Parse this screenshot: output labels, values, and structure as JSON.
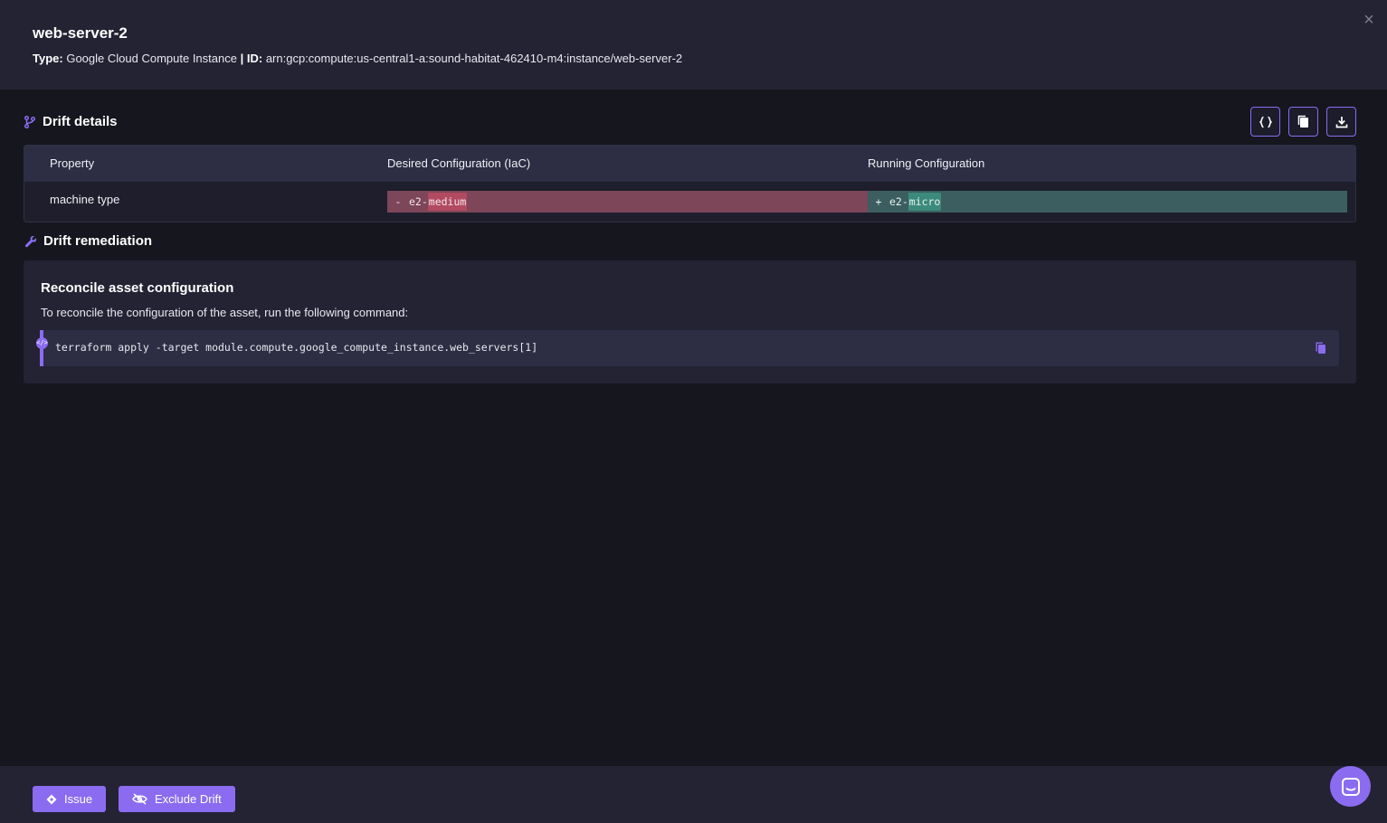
{
  "asset": {
    "name": "web-server-2",
    "type_label": "Type:",
    "type_value": "Google Cloud Compute Instance",
    "separator": "|",
    "id_label": "ID:",
    "id_value": "arn:gcp:compute:us-central1-a:sound-habitat-462410-m4:instance/web-server-2"
  },
  "close_icon": "×",
  "drift_details": {
    "title": "Drift details",
    "icon": "branch-icon",
    "toolbar": [
      "json-icon",
      "copy-icon",
      "download-icon"
    ],
    "columns": [
      "Property",
      "Desired Configuration (IaC)",
      "Running Configuration"
    ],
    "rows": [
      {
        "property": "machine type",
        "desired_sign": "-",
        "desired_prefix": "e2-",
        "desired_highlight": "medium",
        "running_sign": "+",
        "running_prefix": "e2-",
        "running_highlight": "micro"
      }
    ]
  },
  "drift_remediation": {
    "title": "Drift remediation",
    "icon": "wrench-icon",
    "card_title": "Reconcile asset configuration",
    "description": "To reconcile the configuration of the asset, run the following command:",
    "command": "terraform apply -target module.compute.google_compute_instance.web_servers[1]",
    "code_badge": "</>"
  },
  "footer": {
    "issue_label": "Issue",
    "exclude_label": "Exclude Drift"
  },
  "colors": {
    "accent": "#8b6cf0",
    "removed": "#7d4659",
    "added": "#3d5e60"
  }
}
